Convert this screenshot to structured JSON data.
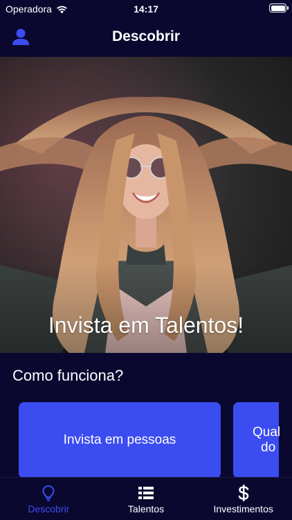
{
  "status_bar": {
    "carrier": "Operadora",
    "time": "14:17"
  },
  "nav": {
    "title": "Descobrir",
    "profile_icon": "person-icon"
  },
  "hero": {
    "title": "Invista em Talentos!"
  },
  "section": {
    "title": "Como funciona?"
  },
  "cards": [
    {
      "label": "Invista em pessoas"
    },
    {
      "label_line1": "Qual",
      "label_line2": "do"
    }
  ],
  "tab_bar": {
    "tabs": [
      {
        "label": "Descobrir",
        "icon": "lightbulb-icon",
        "active": true
      },
      {
        "label": "Talentos",
        "icon": "list-icon",
        "active": false
      },
      {
        "label": "Investimentos",
        "icon": "dollar-icon",
        "active": false
      }
    ]
  },
  "colors": {
    "background": "#0b0830",
    "accent": "#3b4cf0",
    "text": "#ffffff"
  }
}
